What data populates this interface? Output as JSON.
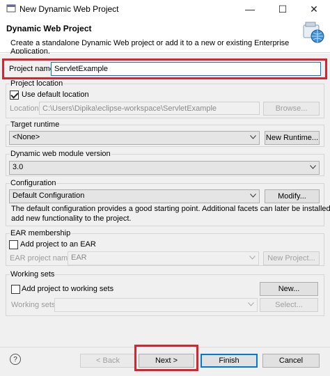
{
  "window": {
    "title": "New Dynamic Web Project",
    "minimize_glyph": "—",
    "maximize_glyph": "☐",
    "close_glyph": "✕"
  },
  "header": {
    "title": "Dynamic Web Project",
    "description": "Create a standalone Dynamic Web project or add it to a new or existing Enterprise Application.",
    "logo_icon": "web-project-wizard-icon"
  },
  "project_name": {
    "label": "Project name:",
    "value": "ServletExample"
  },
  "project_location": {
    "group_label": "Project location",
    "use_default_label": "Use default location",
    "use_default_checked": true,
    "location_label": "Location:",
    "location_value": "C:\\Users\\Dipika\\eclipse-workspace\\ServletExample",
    "browse_label": "Browse..."
  },
  "target_runtime": {
    "group_label": "Target runtime",
    "selected": "<None>",
    "new_runtime_label": "New Runtime..."
  },
  "module_version": {
    "group_label": "Dynamic web module version",
    "selected": "3.0"
  },
  "configuration": {
    "group_label": "Configuration",
    "selected": "Default Configuration",
    "modify_label": "Modify...",
    "description_line1": "The default configuration provides a good starting point. Additional facets can later be installed to",
    "description_line2": "add new functionality to the project."
  },
  "ear_membership": {
    "group_label": "EAR membership",
    "add_label": "Add project to an EAR",
    "add_checked": false,
    "ear_name_label": "EAR project name:",
    "ear_name_value": "EAR",
    "new_project_label": "New Project..."
  },
  "working_sets": {
    "group_label": "Working sets",
    "add_label": "Add project to working sets",
    "add_checked": false,
    "new_label": "New...",
    "sets_label": "Working sets:",
    "select_label": "Select..."
  },
  "footer": {
    "help_glyph": "?",
    "back_label": "< Back",
    "next_label": "Next >",
    "finish_label": "Finish",
    "cancel_label": "Cancel"
  },
  "colors": {
    "highlight_red": "#d9232e",
    "dialog_bg": "#f0f0f0",
    "focus_blue": "#0078d7"
  }
}
